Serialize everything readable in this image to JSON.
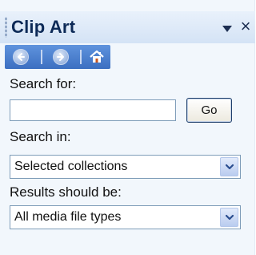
{
  "pane": {
    "title": "Clip Art",
    "accent_color": "#3c6fc1",
    "title_color": "#0d2a57"
  },
  "titlebar": {
    "dropdown_icon": "triangle-down-icon",
    "close_label": "×"
  },
  "nav": {
    "back_icon": "back-arrow-icon",
    "forward_icon": "forward-arrow-icon",
    "home_icon": "home-icon"
  },
  "search": {
    "label": "Search for:",
    "value": "",
    "placeholder": "",
    "go_label": "Go"
  },
  "search_in": {
    "label": "Search in:",
    "selected": "Selected collections"
  },
  "results": {
    "label": "Results should be:",
    "selected": "All media file types"
  }
}
